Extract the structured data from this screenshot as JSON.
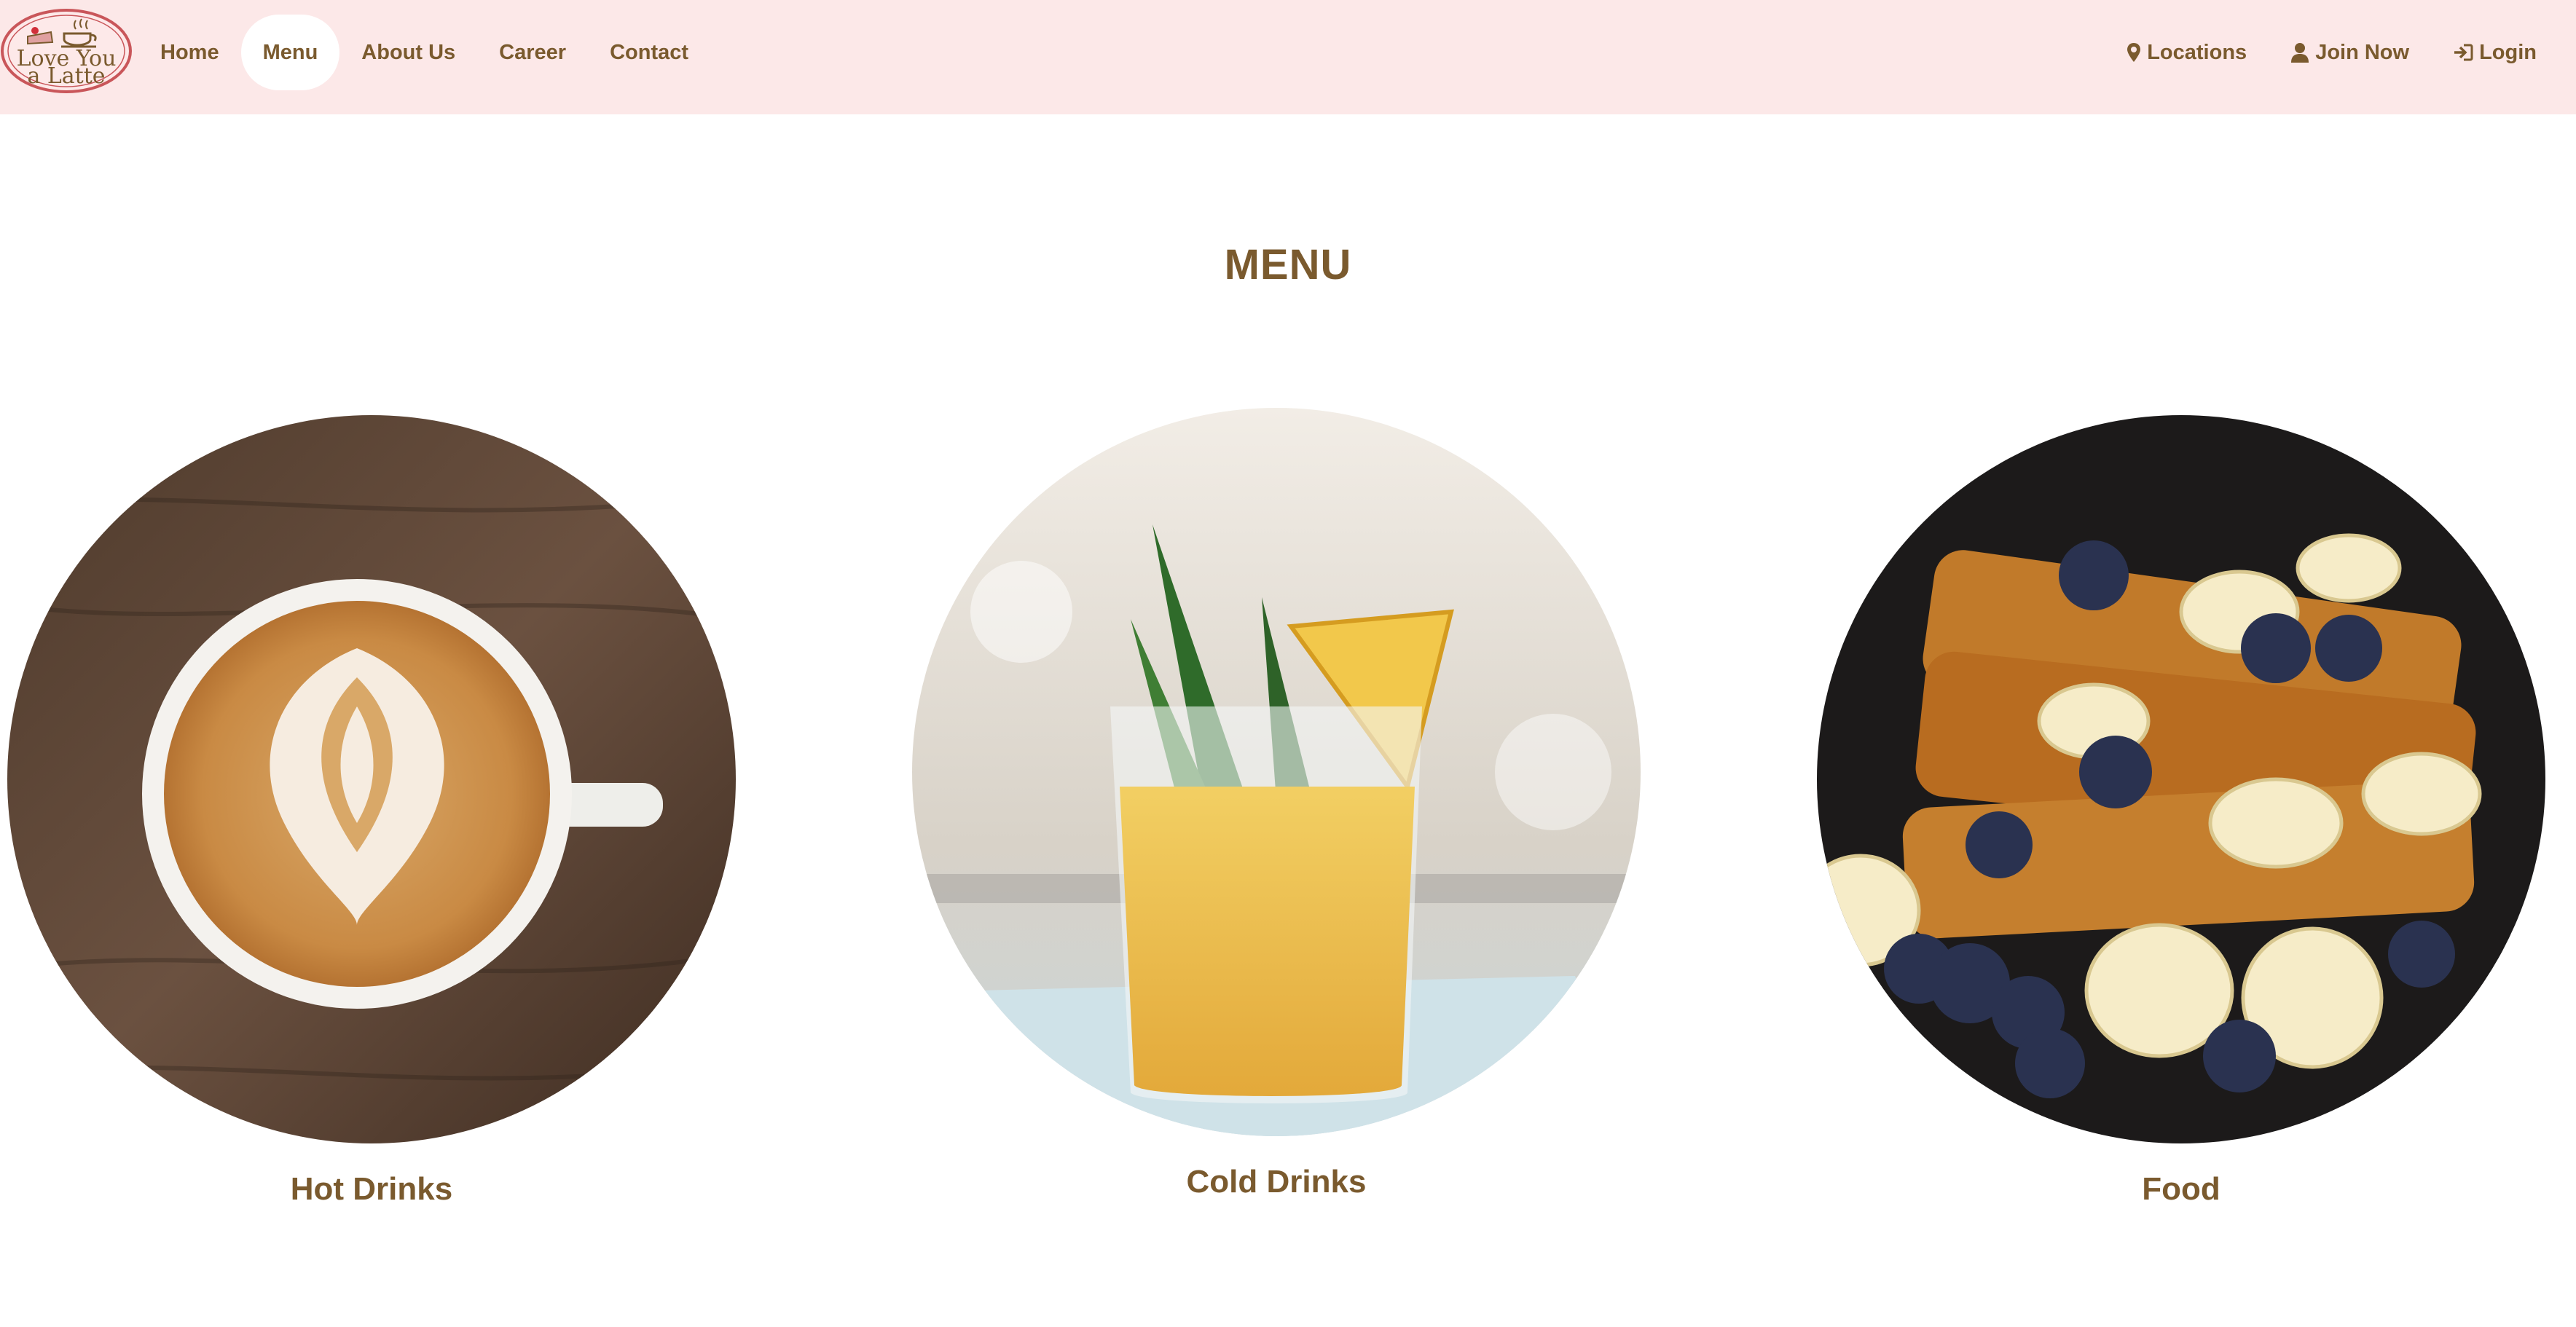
{
  "brand": {
    "logo_line1": "Love You",
    "logo_line2": "a Latte"
  },
  "nav": {
    "left": [
      {
        "label": "Home",
        "active": false
      },
      {
        "label": "Menu",
        "active": true
      },
      {
        "label": "About Us",
        "active": false
      },
      {
        "label": "Career",
        "active": false
      },
      {
        "label": "Contact",
        "active": false
      }
    ],
    "right": [
      {
        "label": "Locations",
        "icon": "map-marker-icon"
      },
      {
        "label": "Join Now",
        "icon": "user-icon"
      },
      {
        "label": "Login",
        "icon": "login-icon"
      }
    ]
  },
  "page": {
    "title": "MENU"
  },
  "menu": {
    "categories": [
      {
        "label": "Hot Drinks",
        "image": "latte-art-cup-photo"
      },
      {
        "label": "Cold Drinks",
        "image": "pineapple-juice-glass-photo"
      },
      {
        "label": "Food",
        "image": "french-toast-banana-blueberry-photo"
      }
    ]
  },
  "colors": {
    "nav_background": "#fce8e8",
    "text_brown": "#7a5a2e",
    "logo_red": "#c9565a",
    "active_pill": "#ffffff"
  }
}
